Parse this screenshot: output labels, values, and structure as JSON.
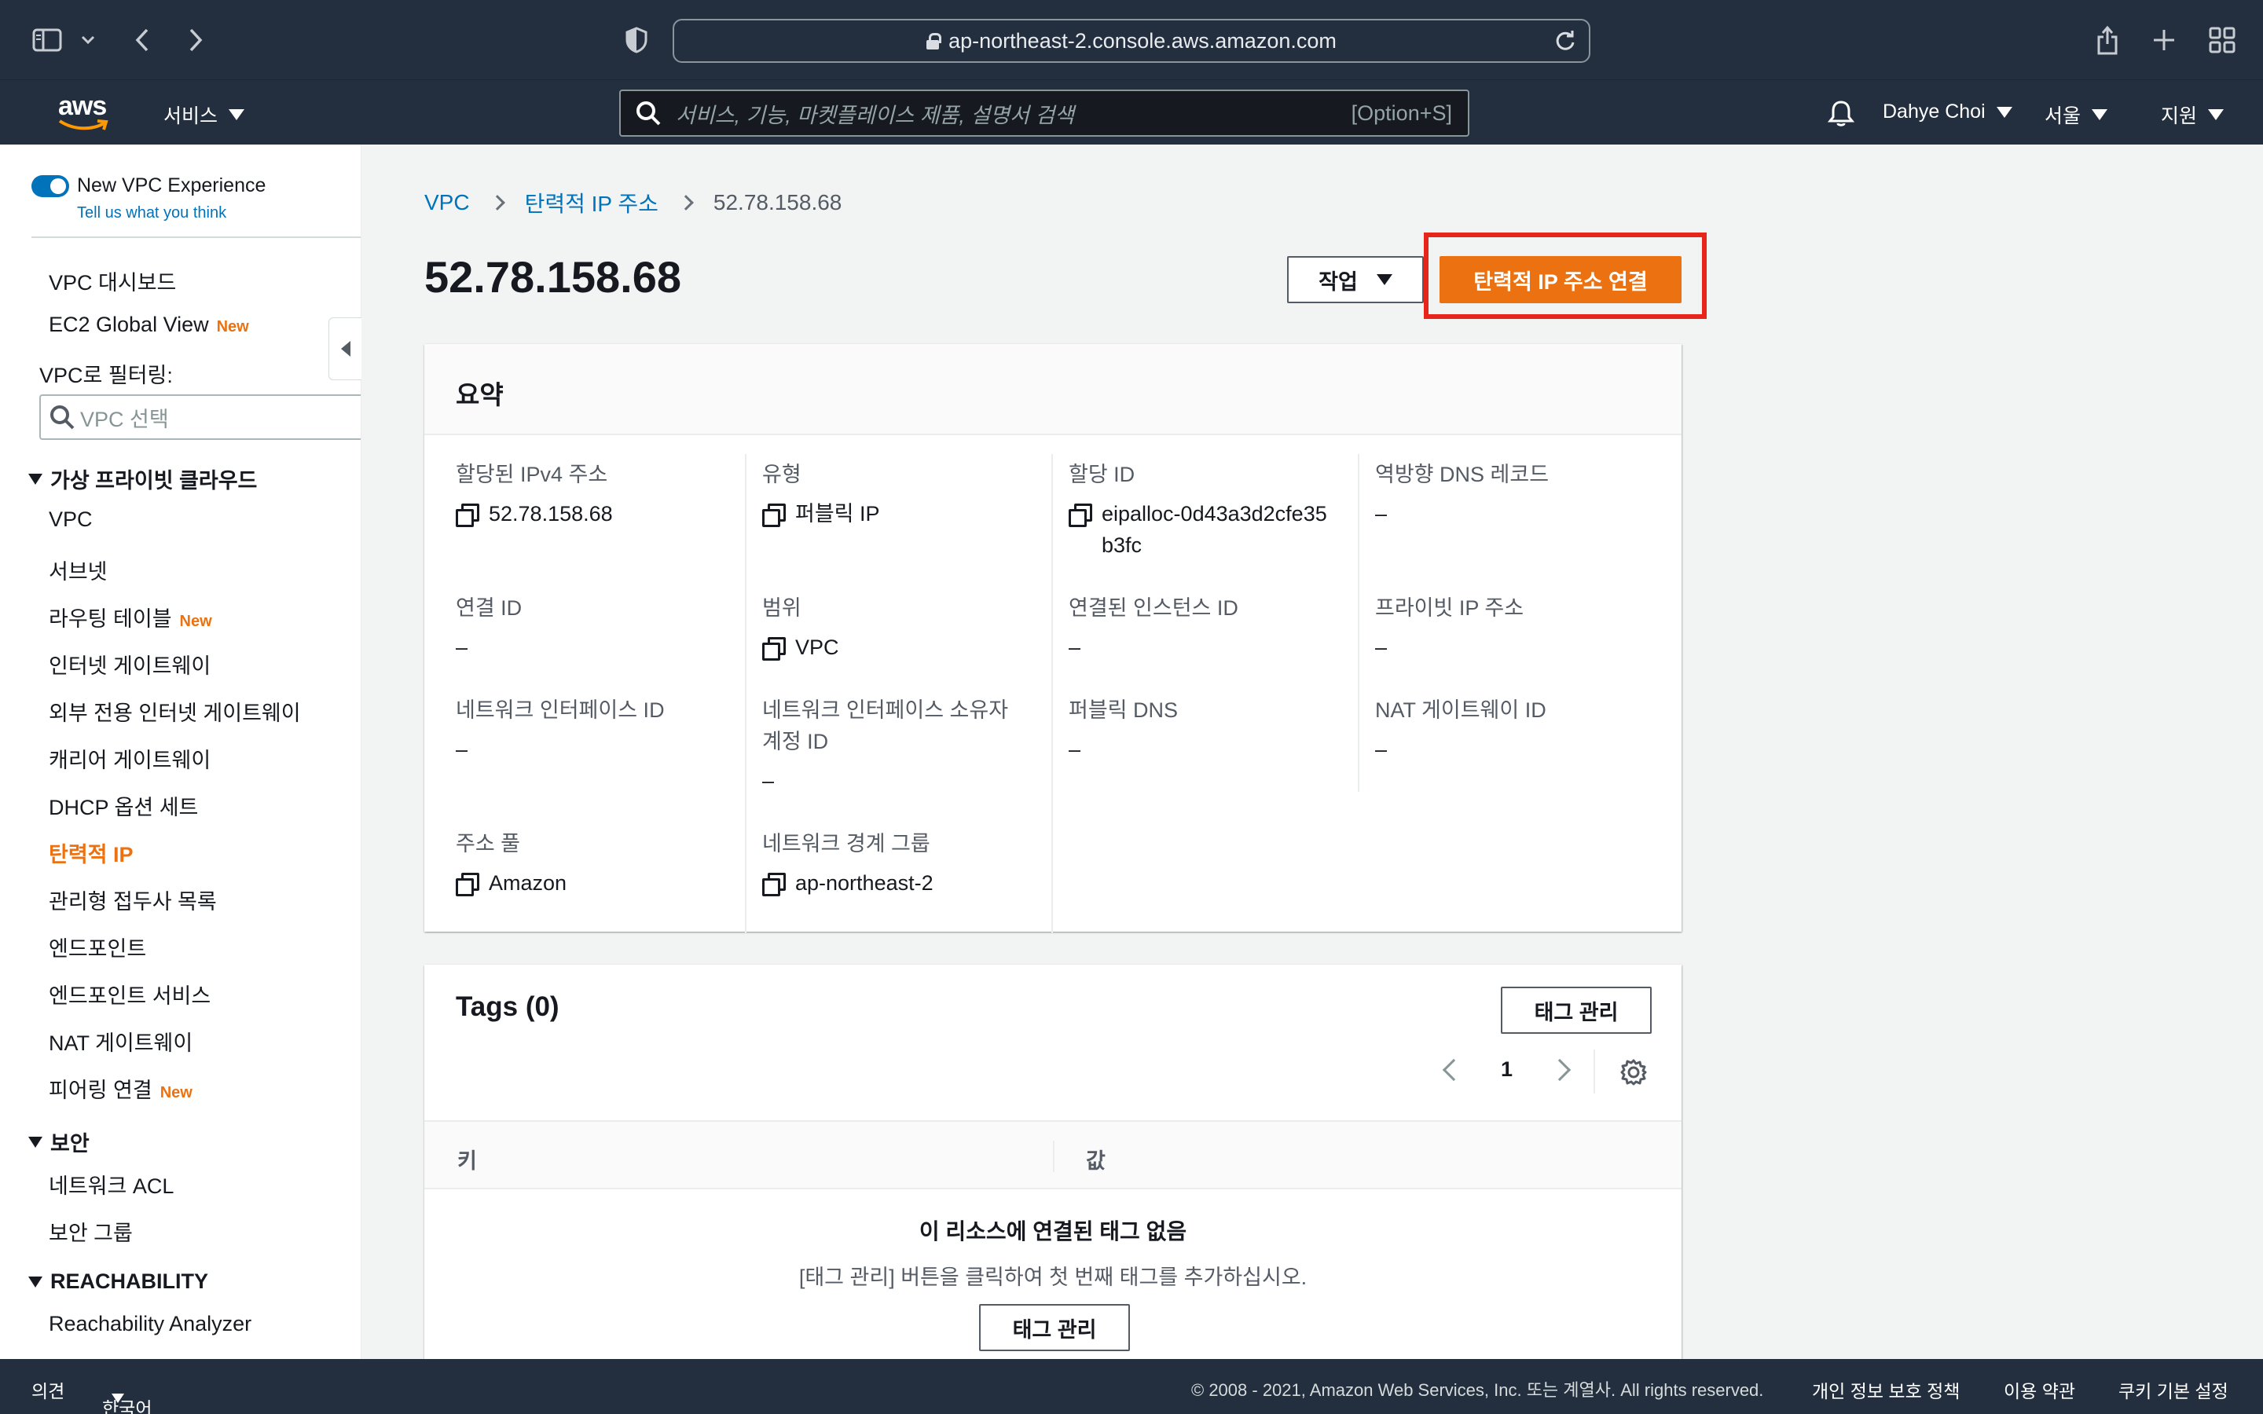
{
  "browser": {
    "url": "ap-northeast-2.console.aws.amazon.com"
  },
  "header": {
    "logo": "aws",
    "services_label": "서비스",
    "search_placeholder": "서비스, 기능, 마켓플레이스 제품, 설명서 검색",
    "search_shortcut": "[Option+S]",
    "user_name": "Dahye Choi",
    "region": "서울",
    "support": "지원"
  },
  "sidebar": {
    "toggle_label": "New VPC Experience",
    "tell_link": "Tell us what you think",
    "top_items": [
      {
        "label": "VPC 대시보드"
      },
      {
        "label": "EC2 Global View",
        "badge": "New"
      }
    ],
    "filter_label": "VPC로 필터링:",
    "filter_placeholder": "VPC 선택",
    "section_vpc": "가상 프라이빗 클라우드",
    "vpc_items": [
      {
        "label": "VPC"
      },
      {
        "label": "서브넷"
      },
      {
        "label": "라우팅 테이블",
        "badge": "New"
      },
      {
        "label": "인터넷 게이트웨이"
      },
      {
        "label": "외부 전용 인터넷 게이트웨이"
      },
      {
        "label": "캐리어 게이트웨이"
      },
      {
        "label": "DHCP 옵션 세트"
      },
      {
        "label": "탄력적 IP",
        "active": true
      },
      {
        "label": "관리형 접두사 목록"
      },
      {
        "label": "엔드포인트"
      },
      {
        "label": "엔드포인트 서비스"
      },
      {
        "label": "NAT 게이트웨이"
      },
      {
        "label": "피어링 연결",
        "badge": "New"
      }
    ],
    "section_security": "보안",
    "security_items": [
      {
        "label": "네트워크 ACL"
      },
      {
        "label": "보안 그룹"
      }
    ],
    "section_reach": "REACHABILITY",
    "reach_items": [
      {
        "label": "Reachability Analyzer"
      }
    ]
  },
  "breadcrumb": {
    "root": "VPC",
    "parent": "탄력적 IP 주소",
    "current": "52.78.158.68"
  },
  "page": {
    "title": "52.78.158.68",
    "actions_label": "작업",
    "associate_label": "탄력적 IP 주소 연결"
  },
  "summary": {
    "heading": "요약",
    "allocated_ipv4_label": "할당된 IPv4 주소",
    "allocated_ipv4_value": "52.78.158.68",
    "type_label": "유형",
    "type_value": "퍼블릭 IP",
    "allocation_id_label": "할당 ID",
    "allocation_id_value": "eipalloc-0d43a3d2cfe35b3fc",
    "reverse_dns_label": "역방향 DNS 레코드",
    "reverse_dns_value": "–",
    "association_id_label": "연결 ID",
    "association_id_value": "–",
    "scope_label": "범위",
    "scope_value": "VPC",
    "instance_id_label": "연결된 인스턴스 ID",
    "instance_id_value": "–",
    "private_ip_label": "프라이빗 IP 주소",
    "private_ip_value": "–",
    "eni_id_label": "네트워크 인터페이스 ID",
    "eni_id_value": "–",
    "eni_owner_label": "네트워크 인터페이스 소유자 계정 ID",
    "eni_owner_value": "–",
    "public_dns_label": "퍼블릭 DNS",
    "public_dns_value": "–",
    "nat_id_label": "NAT 게이트웨이 ID",
    "nat_id_value": "–",
    "pool_label": "주소 풀",
    "pool_value": "Amazon",
    "border_group_label": "네트워크 경계 그룹",
    "border_group_value": "ap-northeast-2"
  },
  "tags": {
    "heading": "Tags (0)",
    "manage_label": "태그 관리",
    "page_number": "1",
    "col_key": "키",
    "col_value": "값",
    "empty_title": "이 리소스에 연결된 태그 없음",
    "empty_desc": "[태그 관리] 버튼을 클릭하여 첫 번째 태그를 추가하십시오.",
    "empty_button": "태그 관리"
  },
  "footer": {
    "feedback": "의견",
    "language": "한국어",
    "copyright": "© 2008 - 2021, Amazon Web Services, Inc. 또는 계열사. All rights reserved.",
    "privacy": "개인 정보 보호 정책",
    "terms": "이용 약관",
    "cookies": "쿠키 기본 설정"
  },
  "colors": {
    "accent": "#ec7211",
    "link": "#0073bb",
    "nav": "#232f3e",
    "highlight": "#e8251a"
  }
}
